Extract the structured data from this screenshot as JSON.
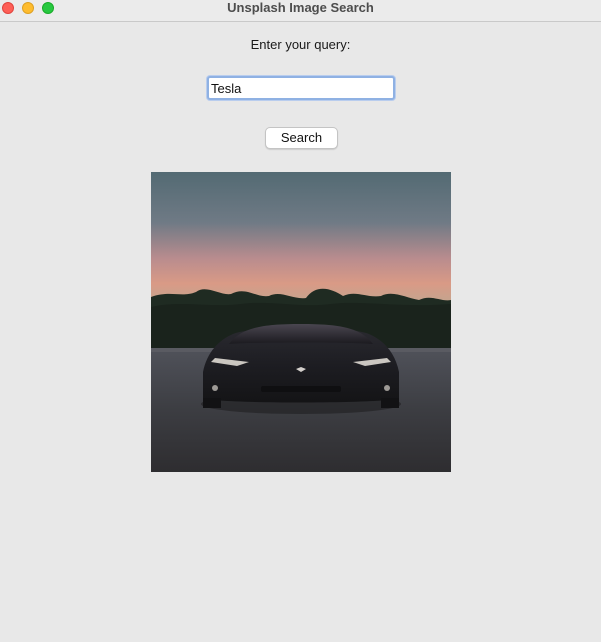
{
  "window": {
    "title": "Unsplash Image Search"
  },
  "form": {
    "query_label": "Enter your query:",
    "query_value": "Tesla",
    "search_label": "Search"
  },
  "result": {
    "image_subject": "car-photo",
    "colors": {
      "sky_top": "#536a73",
      "sunset": "#d99a86",
      "car": "#1d1d22",
      "ground": "#3c3d42"
    }
  },
  "colors": {
    "background": "#e8e8e8",
    "focus_ring": "#8fb1e3",
    "close": "#fe5f57",
    "minimize": "#febc2e",
    "maximize": "#28c840"
  }
}
